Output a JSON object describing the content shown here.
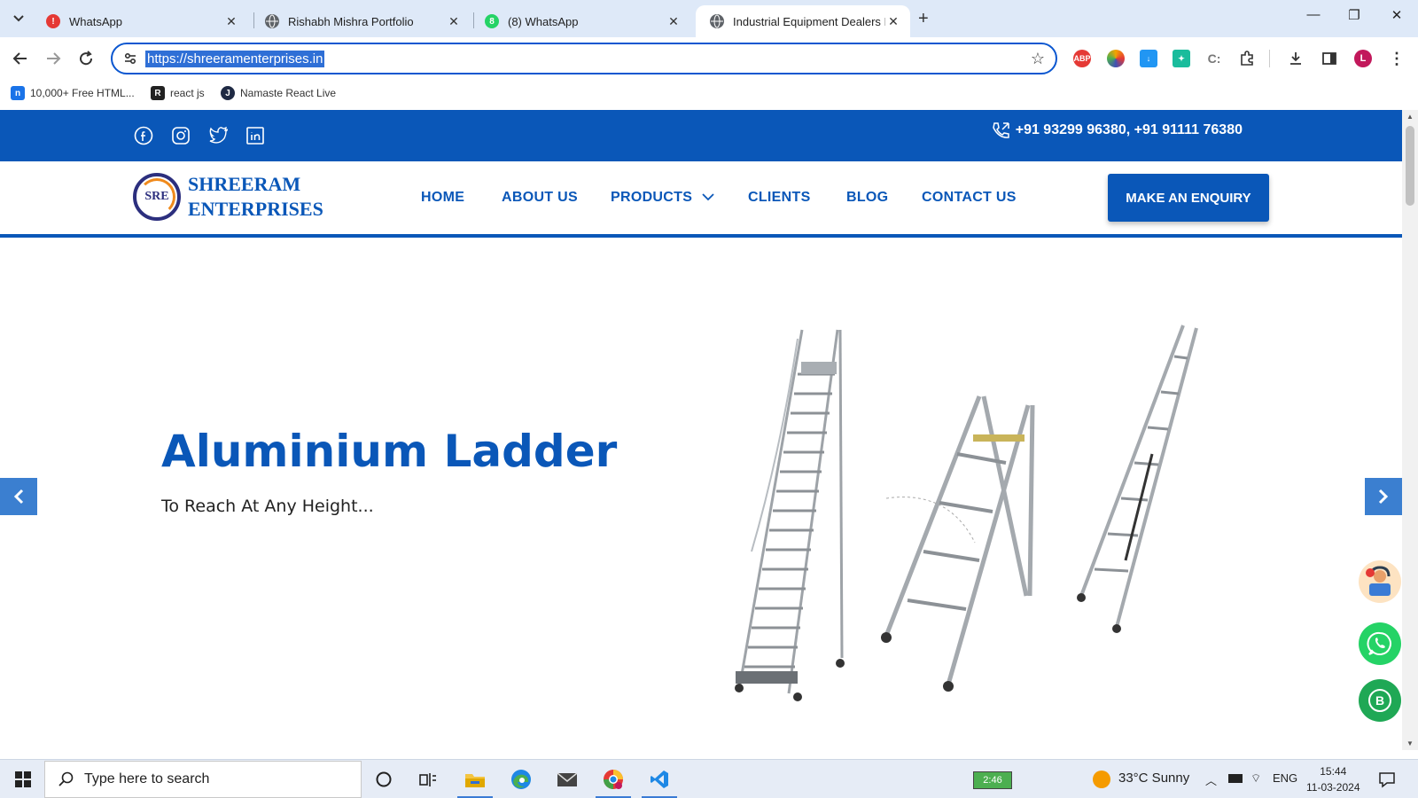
{
  "browser": {
    "tabs": [
      {
        "title": "WhatsApp",
        "favicon_color": "#e53935",
        "favicon_glyph": "!"
      },
      {
        "title": "Rishabh Mishra Portfolio",
        "favicon_color": "#5f6368",
        "favicon_glyph": ""
      },
      {
        "title": "(8) WhatsApp",
        "favicon_color": "#25d366",
        "favicon_glyph": "8"
      },
      {
        "title": "Industrial Equipment Dealers In",
        "favicon_color": "#5f6368",
        "favicon_glyph": ""
      }
    ],
    "url": "https://shreeramenterprises.in",
    "bookmarks": [
      {
        "label": "10,000+ Free HTML...",
        "icon": "n-icon",
        "color": "#1a73e8",
        "glyph": "n"
      },
      {
        "label": "react js",
        "icon": "reactjs-icon",
        "color": "#222222",
        "glyph": "R"
      },
      {
        "label": "Namaste React Live",
        "icon": "namaste-icon",
        "color": "#1f2a44",
        "glyph": "J"
      }
    ],
    "profile_initial": "L",
    "extensions": [
      {
        "name": "adblock-icon",
        "label": "ABP",
        "color": "#e53935"
      },
      {
        "name": "colorful-ext-icon",
        "label": "",
        "color": "#f4a300"
      },
      {
        "name": "download-ext-icon",
        "label": "",
        "color": "#2196f3"
      },
      {
        "name": "pin-ext-icon",
        "label": "",
        "color": "#1abc9c"
      },
      {
        "name": "cx-ext-icon",
        "label": "",
        "color": "#777777"
      }
    ]
  },
  "site": {
    "brand_color": "#0a57b8",
    "phone": "+91 93299 96380,  +91 91111 76380",
    "social": [
      "facebook-icon",
      "instagram-icon",
      "twitter-icon",
      "linkedin-icon"
    ],
    "logo": {
      "seal": "SRE",
      "line1": "SHREERAM",
      "line2": "ENTERPRISES"
    },
    "nav": [
      "HOME",
      "ABOUT US",
      "PRODUCTS",
      "CLIENTS",
      "BLOG",
      "CONTACT US"
    ],
    "cta": "MAKE AN ENQUIRY",
    "hero": {
      "title": "Aluminium Ladder",
      "subtitle": "To Reach At Any Height..."
    }
  },
  "taskbar": {
    "search_placeholder": "Type here to search",
    "battery": "2:46",
    "weather": "33°C  Sunny",
    "lang": "ENG",
    "time": "15:44",
    "date": "11-03-2024"
  }
}
